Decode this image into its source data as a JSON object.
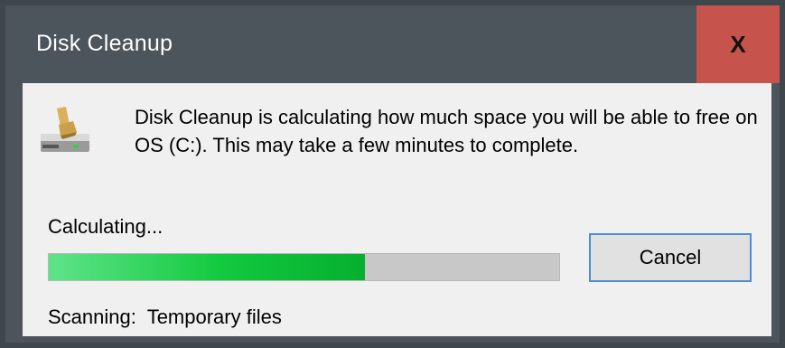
{
  "window": {
    "title": "Disk Cleanup",
    "close_label": "X"
  },
  "dialog": {
    "icon": "disk-cleanup-icon",
    "message": "Disk Cleanup is calculating how much space you will be able to free on OS (C:). This may take a few minutes to complete.",
    "status_label": "Calculating...",
    "progress_fraction": 0.62,
    "cancel_label": "Cancel",
    "scanning_prefix": "Scanning:",
    "scanning_item": "Temporary files"
  },
  "colors": {
    "titlebar": "#4c555b",
    "close_hover": "#c7544c",
    "progress_fill": "#06b030",
    "button_focus_border": "#4a8fd6"
  }
}
